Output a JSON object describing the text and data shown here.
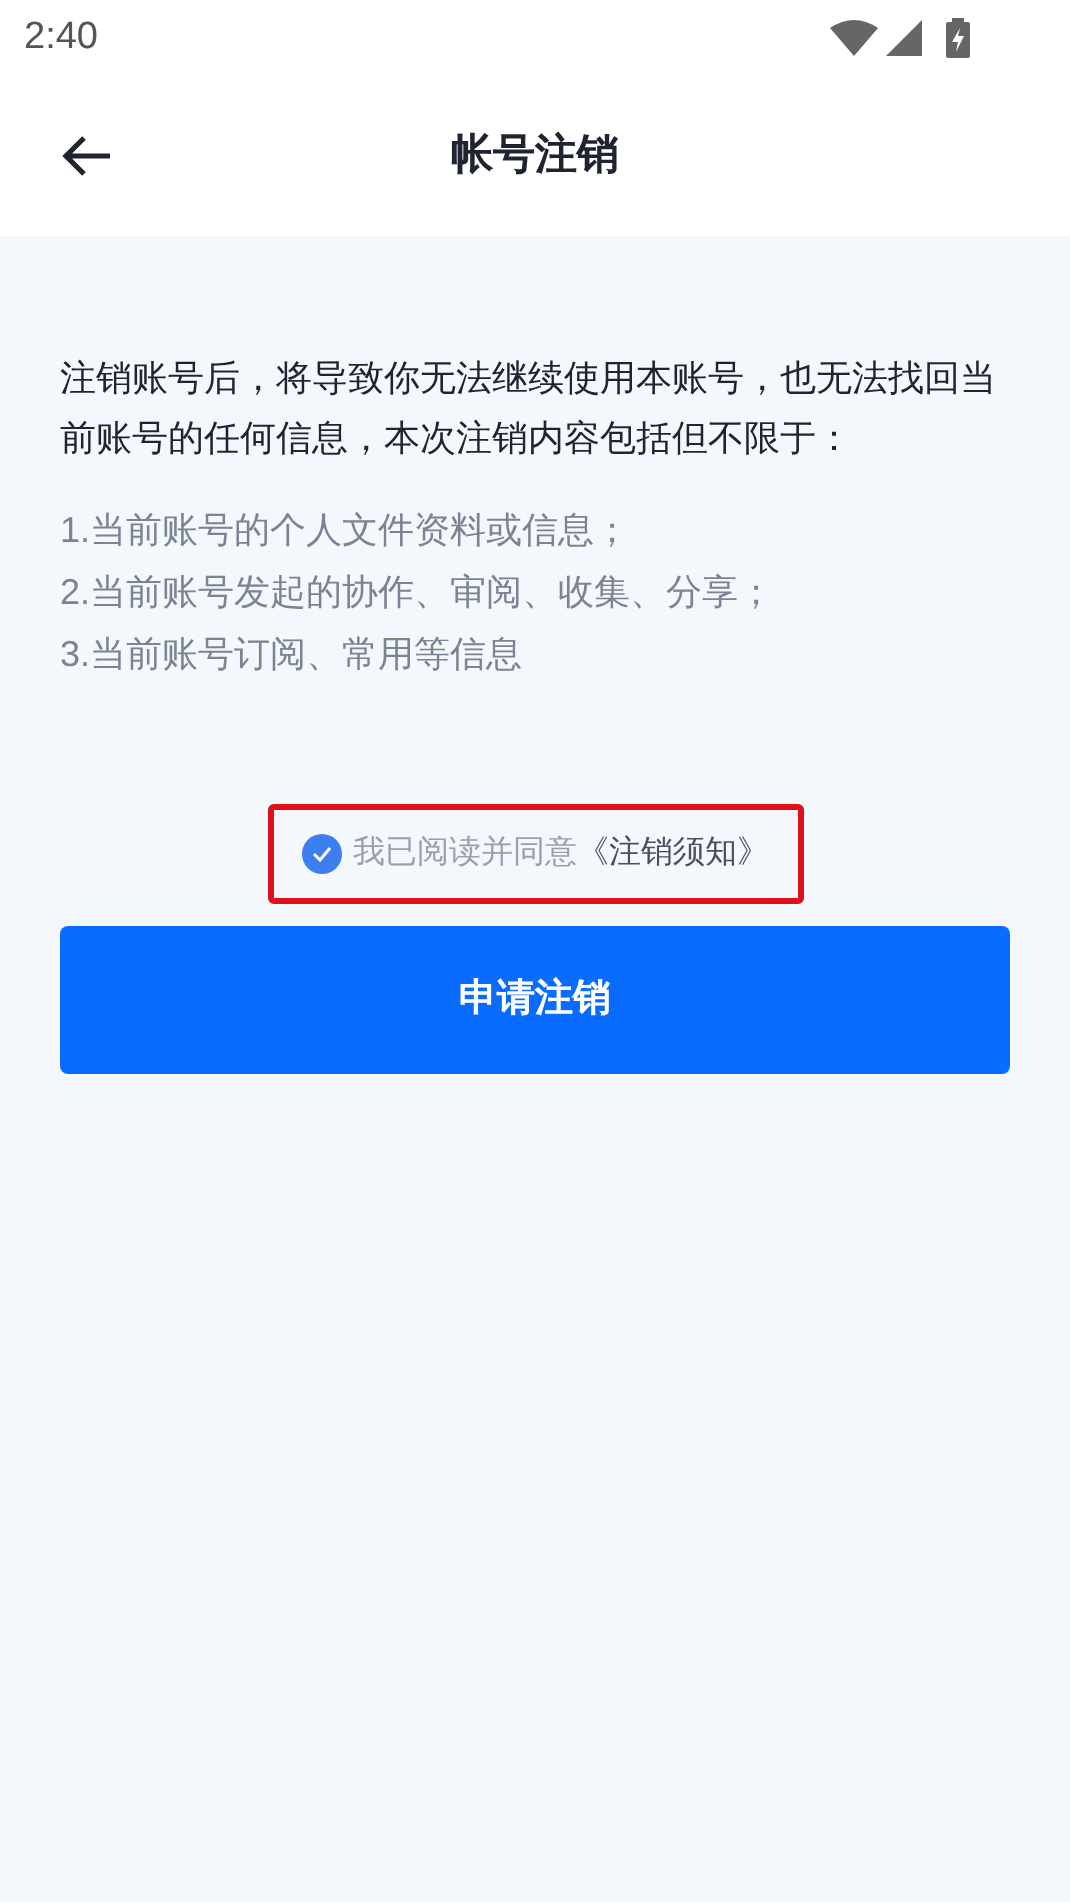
{
  "status_bar": {
    "time": "2:40"
  },
  "header": {
    "title": "帐号注销"
  },
  "notice": {
    "intro": "注销账号后，将导致你无法继续使用本账号，也无法找回当前账号的任何信息，本次注销内容包括但不限于：",
    "items": [
      "1.当前账号的个人文件资料或信息；",
      "2.当前账号发起的协作、审阅、收集、分享；",
      "3.当前账号订阅、常用等信息"
    ]
  },
  "agreement": {
    "checked": true,
    "label": "我已阅读并同意",
    "link": "《注销须知》",
    "highlighted": true
  },
  "submit_button": "申请注销"
}
